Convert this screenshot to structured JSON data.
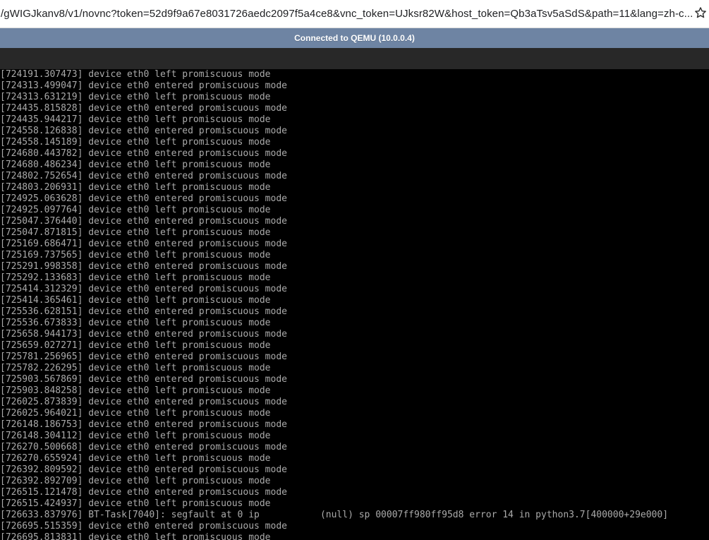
{
  "browser": {
    "url": "/gWIGJkanv8/v1/novnc?token=52d9f9a67e8031726aedc2097f5a4ce8&vnc_token=UJksr82W&host_token=Qb3aTsv5aSdS&path=11&lang=zh-c...",
    "star_icon": "star-outline-icon"
  },
  "vnc": {
    "status": "Connected to QEMU (10.0.0.4)"
  },
  "colors": {
    "status_bar": "#6e84a3",
    "console_bg": "#000000",
    "console_text": "#aaaaaa"
  },
  "console": {
    "lines": [
      "[724191.307473] device eth0 left promiscuous mode",
      "[724313.499047] device eth0 entered promiscuous mode",
      "[724313.631219] device eth0 left promiscuous mode",
      "[724435.815828] device eth0 entered promiscuous mode",
      "[724435.944217] device eth0 left promiscuous mode",
      "[724558.126838] device eth0 entered promiscuous mode",
      "[724558.145189] device eth0 left promiscuous mode",
      "[724680.443782] device eth0 entered promiscuous mode",
      "[724680.486234] device eth0 left promiscuous mode",
      "[724802.752654] device eth0 entered promiscuous mode",
      "[724803.206931] device eth0 left promiscuous mode",
      "[724925.063628] device eth0 entered promiscuous mode",
      "[724925.097764] device eth0 left promiscuous mode",
      "[725047.376440] device eth0 entered promiscuous mode",
      "[725047.871815] device eth0 left promiscuous mode",
      "[725169.686471] device eth0 entered promiscuous mode",
      "[725169.737565] device eth0 left promiscuous mode",
      "[725291.998358] device eth0 entered promiscuous mode",
      "[725292.133683] device eth0 left promiscuous mode",
      "[725414.312329] device eth0 entered promiscuous mode",
      "[725414.365461] device eth0 left promiscuous mode",
      "[725536.628151] device eth0 entered promiscuous mode",
      "[725536.673833] device eth0 left promiscuous mode",
      "[725658.944173] device eth0 entered promiscuous mode",
      "[725659.027271] device eth0 left promiscuous mode",
      "[725781.256965] device eth0 entered promiscuous mode",
      "[725782.226295] device eth0 left promiscuous mode",
      "[725903.567869] device eth0 entered promiscuous mode",
      "[725903.848258] device eth0 left promiscuous mode",
      "[726025.873839] device eth0 entered promiscuous mode",
      "[726025.964021] device eth0 left promiscuous mode",
      "[726148.186753] device eth0 entered promiscuous mode",
      "[726148.304112] device eth0 left promiscuous mode",
      "[726270.500668] device eth0 entered promiscuous mode",
      "[726270.655924] device eth0 left promiscuous mode",
      "[726392.809592] device eth0 entered promiscuous mode",
      "[726392.892709] device eth0 left promiscuous mode",
      "[726515.121478] device eth0 entered promiscuous mode",
      "[726515.424937] device eth0 left promiscuous mode",
      "[726633.837976] BT-Task[7040]: segfault at 0 ip           (null) sp 00007ff980ff95d8 error 14 in python3.7[400000+29e000]",
      "[726695.515359] device eth0 entered promiscuous mode",
      "[726695.813831] device eth0 left promiscuous mode"
    ]
  }
}
